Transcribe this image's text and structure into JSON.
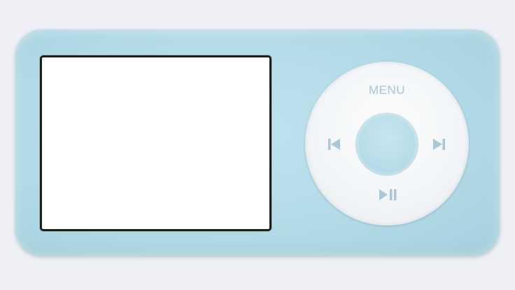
{
  "player": {
    "menu_label": "MENU",
    "icons": {
      "previous": "previous-track-icon",
      "next": "next-track-icon",
      "play_pause": "play-pause-icon"
    },
    "colors": {
      "body": "#b3dbe7",
      "wheel": "#f2f5f7",
      "center_button": "#b8dde8",
      "control_glyph": "#a9c8d6",
      "screen": "#ffffff",
      "screen_border": "#1e1e1e"
    }
  }
}
